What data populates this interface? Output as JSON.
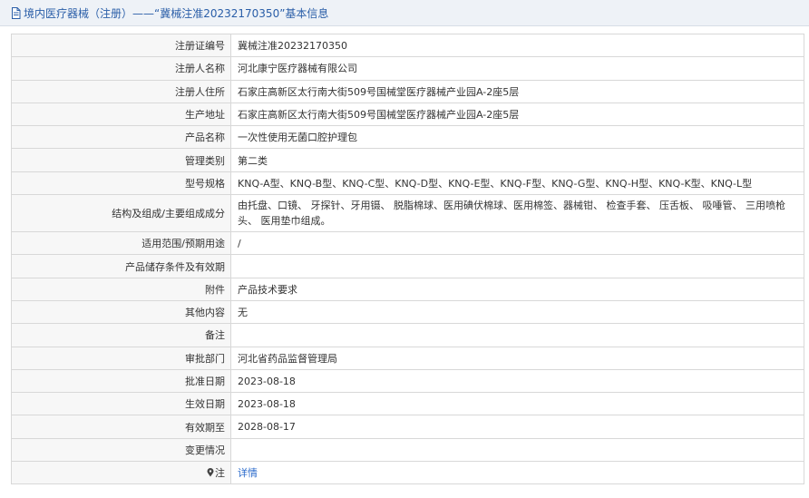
{
  "header": {
    "title": "境内医疗器械（注册）——“冀械注准20232170350”基本信息"
  },
  "rows": [
    {
      "label": "注册证编号",
      "value": "冀械注准20232170350"
    },
    {
      "label": "注册人名称",
      "value": "河北康宁医疗器械有限公司"
    },
    {
      "label": "注册人住所",
      "value": "石家庄高新区太行南大街509号国械堂医疗器械产业园A-2座5层"
    },
    {
      "label": "生产地址",
      "value": "石家庄高新区太行南大街509号国械堂医疗器械产业园A-2座5层"
    },
    {
      "label": "产品名称",
      "value": "一次性使用无菌口腔护理包"
    },
    {
      "label": "管理类别",
      "value": "第二类"
    },
    {
      "label": "型号规格",
      "value": "KNQ-A型、KNQ-B型、KNQ-C型、KNQ-D型、KNQ-E型、KNQ-F型、KNQ-G型、KNQ-H型、KNQ-K型、KNQ-L型"
    },
    {
      "label": "结构及组成/主要组成成分",
      "value": "由托盘、口镜、 牙探针、牙用镊、 脱脂棉球、医用碘伏棉球、医用棉签、器械钳、 检查手套、 压舌板、 吸唾管、 三用喷枪头、 医用垫巾组成。"
    },
    {
      "label": "适用范围/预期用途",
      "value": "/"
    },
    {
      "label": "产品储存条件及有效期",
      "value": ""
    },
    {
      "label": "附件",
      "value": "产品技术要求"
    },
    {
      "label": "其他内容",
      "value": "无"
    },
    {
      "label": "备注",
      "value": ""
    },
    {
      "label": "审批部门",
      "value": "河北省药品监督管理局"
    },
    {
      "label": "批准日期",
      "value": "2023-08-18"
    },
    {
      "label": "生效日期",
      "value": "2023-08-18"
    },
    {
      "label": "有效期至",
      "value": "2028-08-17"
    },
    {
      "label": "变更情况",
      "value": ""
    },
    {
      "label": "注",
      "value": "详情",
      "icon": "map-pin-icon"
    }
  ]
}
